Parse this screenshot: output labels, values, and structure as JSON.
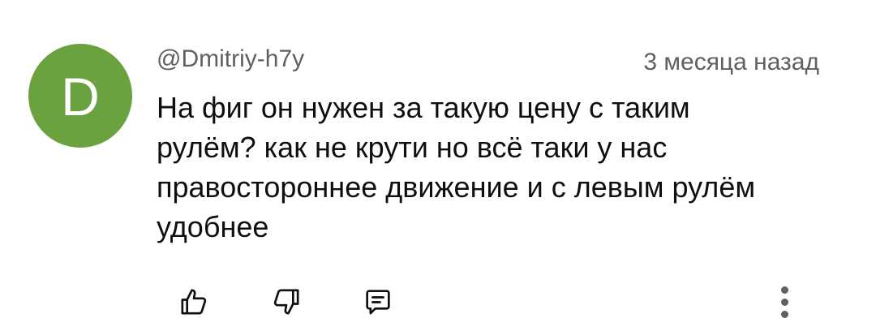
{
  "comment": {
    "author": "@Dmitriy-h7y",
    "avatar_letter": "D",
    "avatar_color": "#6aa23f",
    "timestamp": "3 месяца назад",
    "text_lines": [
      "На фиг он нужен за такую цену с таким",
      "рулём? как не крути но всё таки у нас",
      "правостороннее движение и с левым рулём",
      "удобнее"
    ]
  },
  "actions": {
    "like_icon": "thumbs-up-icon",
    "dislike_icon": "thumbs-down-icon",
    "reply_icon": "comment-icon",
    "menu_icon": "more-vertical-icon"
  },
  "colors": {
    "secondary_text": "#606060",
    "primary_text": "#0f0f0f"
  }
}
